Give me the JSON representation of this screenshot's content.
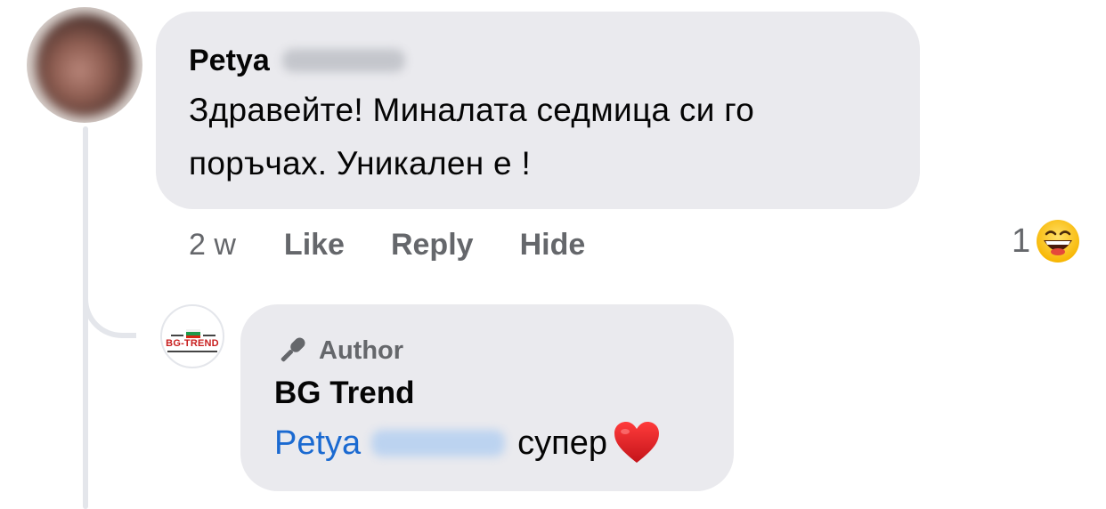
{
  "main_comment": {
    "author_first_name": "Petya",
    "text": "Здравейте! Миналата седмица си го поръчах. Уникален е !",
    "time": "2 w",
    "actions": {
      "like": "Like",
      "reply": "Reply",
      "hide": "Hide"
    },
    "reaction_count": "1",
    "reaction_icon": "grinning-squinting-face-icon"
  },
  "reply_comment": {
    "badge": "Author",
    "badge_icon": "microphone-icon",
    "author_name": "BG Trend",
    "avatar_logo_text": "BG-TREND",
    "mention_first_name": "Petya",
    "text": "супер",
    "emoji": "red-heart-icon"
  },
  "colors": {
    "bubble": "#eaeaee",
    "meta_text": "#65676b",
    "mention": "#1b6ad1",
    "logo_red": "#c81e1e"
  }
}
